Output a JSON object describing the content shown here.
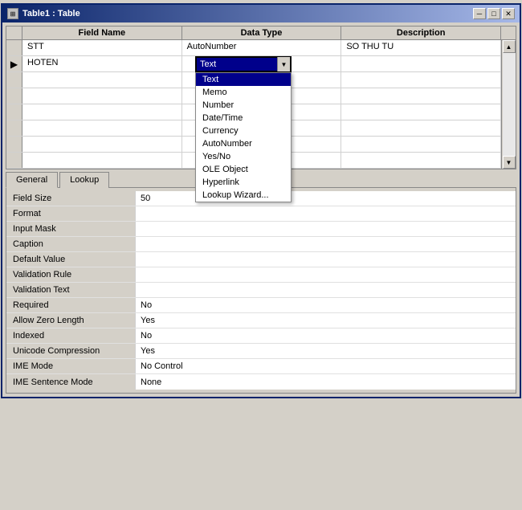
{
  "window": {
    "title": "Table1 : Table",
    "icon": "⊞",
    "buttons": {
      "minimize": "─",
      "maximize": "□",
      "close": "✕"
    }
  },
  "table": {
    "columns": {
      "row_indicator": "",
      "field_name": "Field Name",
      "data_type": "Data Type",
      "description": "Description"
    },
    "rows": [
      {
        "id": 1,
        "field_name": "STT",
        "data_type": "AutoNumber",
        "description": "SO THU TU",
        "is_current": false
      },
      {
        "id": 2,
        "field_name": "HOTEN",
        "data_type": "Text",
        "description": "",
        "is_current": true
      },
      {
        "id": 3,
        "field_name": "",
        "data_type": "",
        "description": "",
        "is_current": false
      },
      {
        "id": 4,
        "field_name": "",
        "data_type": "",
        "description": "",
        "is_current": false
      },
      {
        "id": 5,
        "field_name": "",
        "data_type": "",
        "description": "",
        "is_current": false
      },
      {
        "id": 6,
        "field_name": "",
        "data_type": "",
        "description": "",
        "is_current": false
      },
      {
        "id": 7,
        "field_name": "",
        "data_type": "",
        "description": "",
        "is_current": false
      },
      {
        "id": 8,
        "field_name": "",
        "data_type": "",
        "description": "",
        "is_current": false
      }
    ]
  },
  "dropdown": {
    "current_value": "Text",
    "items": [
      {
        "label": "Text",
        "selected": true
      },
      {
        "label": "Memo",
        "selected": false
      },
      {
        "label": "Number",
        "selected": false
      },
      {
        "label": "Date/Time",
        "selected": false
      },
      {
        "label": "Currency",
        "selected": false
      },
      {
        "label": "AutoNumber",
        "selected": false
      },
      {
        "label": "Yes/No",
        "selected": false
      },
      {
        "label": "OLE Object",
        "selected": false
      },
      {
        "label": "Hyperlink",
        "selected": false
      },
      {
        "label": "Lookup Wizard...",
        "selected": false
      }
    ]
  },
  "tabs": {
    "items": [
      {
        "label": "General",
        "active": true
      },
      {
        "label": "Lookup",
        "active": false
      }
    ]
  },
  "properties": {
    "fields": [
      {
        "label": "Field Size",
        "value": "50"
      },
      {
        "label": "Format",
        "value": ""
      },
      {
        "label": "Input Mask",
        "value": ""
      },
      {
        "label": "Caption",
        "value": ""
      },
      {
        "label": "Default Value",
        "value": ""
      },
      {
        "label": "Validation Rule",
        "value": ""
      },
      {
        "label": "Validation Text",
        "value": ""
      },
      {
        "label": "Required",
        "value": "No"
      },
      {
        "label": "Allow Zero Length",
        "value": "Yes"
      },
      {
        "label": "Indexed",
        "value": "No"
      },
      {
        "label": "Unicode Compression",
        "value": "Yes"
      },
      {
        "label": "IME Mode",
        "value": "No Control"
      },
      {
        "label": "IME Sentence Mode",
        "value": "None"
      }
    ]
  }
}
